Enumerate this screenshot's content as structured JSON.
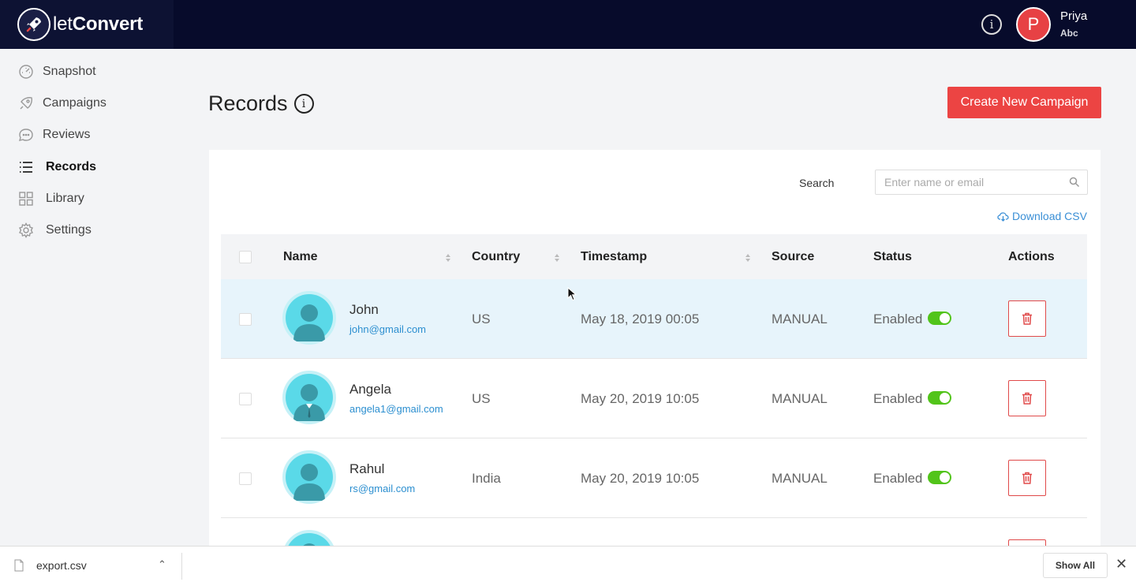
{
  "app": {
    "logo_let": "let",
    "logo_convert": "Convert",
    "user": {
      "initial": "P",
      "name": "Priya",
      "org": "Abc"
    },
    "top_info_glyph": "i"
  },
  "sidebar": {
    "items": [
      {
        "label": "Snapshot",
        "icon": "speedometer-icon",
        "active": false
      },
      {
        "label": "Campaigns",
        "icon": "rocket-icon",
        "active": false
      },
      {
        "label": "Reviews",
        "icon": "chat-bubble-icon",
        "active": false
      },
      {
        "label": "Records",
        "icon": "list-icon",
        "active": true
      },
      {
        "label": "Library",
        "icon": "grid-icon",
        "active": false
      },
      {
        "label": "Settings",
        "icon": "gear-icon",
        "active": false
      }
    ]
  },
  "header": {
    "title": "Records",
    "info_glyph": "i",
    "create_button": "Create New Campaign"
  },
  "search": {
    "label": "Search",
    "placeholder": "Enter name or email",
    "value": ""
  },
  "download_csv": "Download CSV",
  "table": {
    "columns": [
      "Name",
      "Country",
      "Timestamp",
      "Source",
      "Status",
      "Actions"
    ],
    "rows": [
      {
        "name": "John",
        "email": "john@gmail.com",
        "country": "US",
        "timestamp": "May 18, 2019 00:05",
        "source": "MANUAL",
        "status": "Enabled",
        "enabled": true
      },
      {
        "name": "Angela",
        "email": "angela1@gmail.com",
        "country": "US",
        "timestamp": "May 20, 2019 10:05",
        "source": "MANUAL",
        "status": "Enabled",
        "enabled": true
      },
      {
        "name": "Rahul",
        "email": "rs@gmail.com",
        "country": "India",
        "timestamp": "May 20, 2019 10:05",
        "source": "MANUAL",
        "status": "Enabled",
        "enabled": true
      }
    ]
  },
  "download_bar": {
    "file_name": "export.csv",
    "show_all": "Show All",
    "close_glyph": "✕",
    "caret_glyph": "⌃"
  },
  "colors": {
    "topbar": "#070b2b",
    "accent_red": "#ec4443",
    "link_blue": "#2c8fd0",
    "toggle_green": "#52c41a",
    "avatar_cyan": "#5ad9e8"
  }
}
